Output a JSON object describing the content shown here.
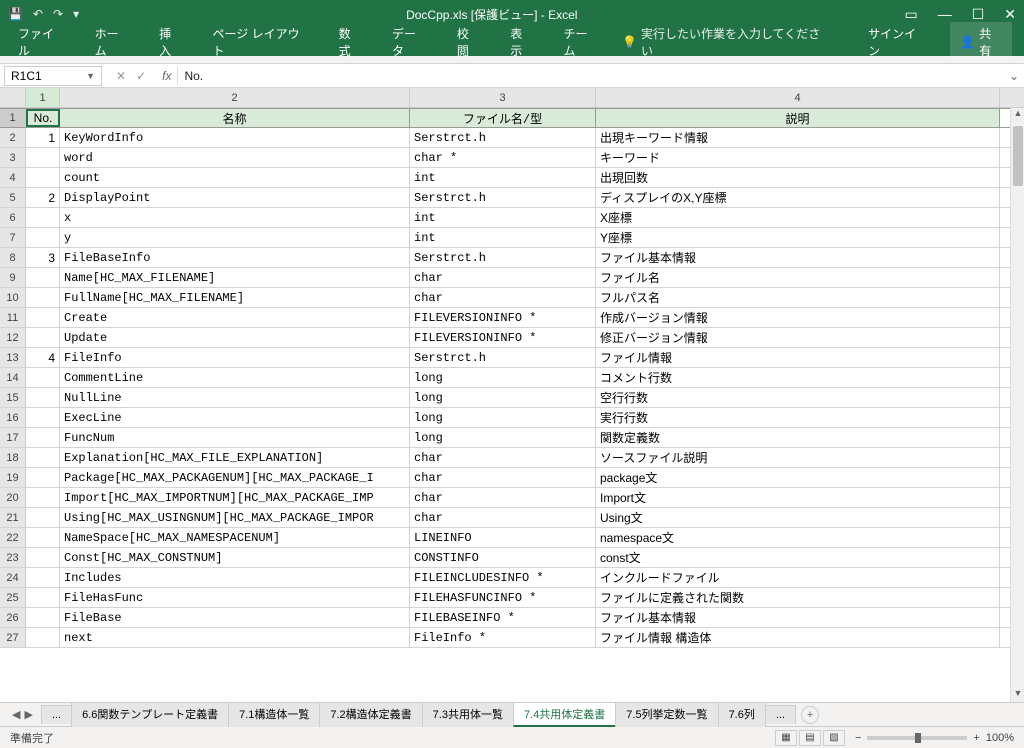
{
  "title": "DocCpp.xls [保護ビュー] - Excel",
  "qa": {
    "save": "💾",
    "undo": "↶",
    "redo": "↷"
  },
  "ribbon": {
    "tabs": [
      "ファイル",
      "ホーム",
      "挿入",
      "ページ レイアウト",
      "数式",
      "データ",
      "校閲",
      "表示",
      "チーム"
    ],
    "tell": "実行したい作業を入力してください",
    "signin": "サインイン",
    "share": "共有"
  },
  "formula": {
    "namebox": "R1C1",
    "value": "No."
  },
  "columns": [
    "1",
    "2",
    "3",
    "4"
  ],
  "header_row": {
    "no": "No.",
    "name": "名称",
    "file": "ファイル名/型",
    "desc": "説明"
  },
  "rows": [
    {
      "r": "2",
      "no": "1",
      "name": "KeyWordInfo",
      "file": "Serstrct.h",
      "desc": "出現キーワード情報"
    },
    {
      "r": "3",
      "no": "",
      "name": "word",
      "file": "char *",
      "desc": "キーワード"
    },
    {
      "r": "4",
      "no": "",
      "name": "count",
      "file": "int",
      "desc": "出現回数"
    },
    {
      "r": "5",
      "no": "2",
      "name": "DisplayPoint",
      "file": "Serstrct.h",
      "desc": "ディスプレイのX,Y座標"
    },
    {
      "r": "6",
      "no": "",
      "name": "x",
      "file": "int",
      "desc": "X座標"
    },
    {
      "r": "7",
      "no": "",
      "name": "y",
      "file": "int",
      "desc": "Y座標"
    },
    {
      "r": "8",
      "no": "3",
      "name": "FileBaseInfo",
      "file": "Serstrct.h",
      "desc": "ファイル基本情報"
    },
    {
      "r": "9",
      "no": "",
      "name": "Name[HC_MAX_FILENAME]",
      "file": "char",
      "desc": "ファイル名"
    },
    {
      "r": "10",
      "no": "",
      "name": "FullName[HC_MAX_FILENAME]",
      "file": "char",
      "desc": "フルパス名"
    },
    {
      "r": "11",
      "no": "",
      "name": "Create",
      "file": "FILEVERSIONINFO *",
      "desc": "作成バージョン情報"
    },
    {
      "r": "12",
      "no": "",
      "name": "Update",
      "file": "FILEVERSIONINFO *",
      "desc": "修正バージョン情報"
    },
    {
      "r": "13",
      "no": "4",
      "name": "FileInfo",
      "file": "Serstrct.h",
      "desc": "ファイル情報"
    },
    {
      "r": "14",
      "no": "",
      "name": "CommentLine",
      "file": "long",
      "desc": "コメント行数"
    },
    {
      "r": "15",
      "no": "",
      "name": "NullLine",
      "file": "long",
      "desc": "空行行数"
    },
    {
      "r": "16",
      "no": "",
      "name": "ExecLine",
      "file": "long",
      "desc": "実行行数"
    },
    {
      "r": "17",
      "no": "",
      "name": "FuncNum",
      "file": "long",
      "desc": "関数定義数"
    },
    {
      "r": "18",
      "no": "",
      "name": "Explanation[HC_MAX_FILE_EXPLANATION]",
      "file": "char",
      "desc": "ソースファイル説明"
    },
    {
      "r": "19",
      "no": "",
      "name": "Package[HC_MAX_PACKAGENUM][HC_MAX_PACKAGE_I",
      "file": "char",
      "desc": "package文"
    },
    {
      "r": "20",
      "no": "",
      "name": "Import[HC_MAX_IMPORTNUM][HC_MAX_PACKAGE_IMP",
      "file": "char",
      "desc": "Import文"
    },
    {
      "r": "21",
      "no": "",
      "name": "Using[HC_MAX_USINGNUM][HC_MAX_PACKAGE_IMPOR",
      "file": "char",
      "desc": "Using文"
    },
    {
      "r": "22",
      "no": "",
      "name": "NameSpace[HC_MAX_NAMESPACENUM]",
      "file": "LINEINFO",
      "desc": "namespace文"
    },
    {
      "r": "23",
      "no": "",
      "name": "Const[HC_MAX_CONSTNUM]",
      "file": "CONSTINFO",
      "desc": "const文"
    },
    {
      "r": "24",
      "no": "",
      "name": "Includes",
      "file": "FILEINCLUDESINFO *",
      "desc": "インクルードファイル"
    },
    {
      "r": "25",
      "no": "",
      "name": "FileHasFunc",
      "file": "FILEHASFUNCINFO *",
      "desc": "ファイルに定義された関数"
    },
    {
      "r": "26",
      "no": "",
      "name": "FileBase",
      "file": "FILEBASEINFO *",
      "desc": "ファイル基本情報"
    },
    {
      "r": "27",
      "no": "",
      "name": "next",
      "file": "FileInfo *",
      "desc": "ファイル情報 構造体"
    }
  ],
  "sheets": {
    "ellipsis": "...",
    "tabs": [
      "6.6関数テンプレート定義書",
      "7.1構造体一覧",
      "7.2構造体定義書",
      "7.3共用体一覧",
      "7.4共用体定義書",
      "7.5列挙定数一覧",
      "7.6列"
    ],
    "active_index": 4,
    "more": "..."
  },
  "status": {
    "ready": "準備完了",
    "zoom": "100%"
  }
}
